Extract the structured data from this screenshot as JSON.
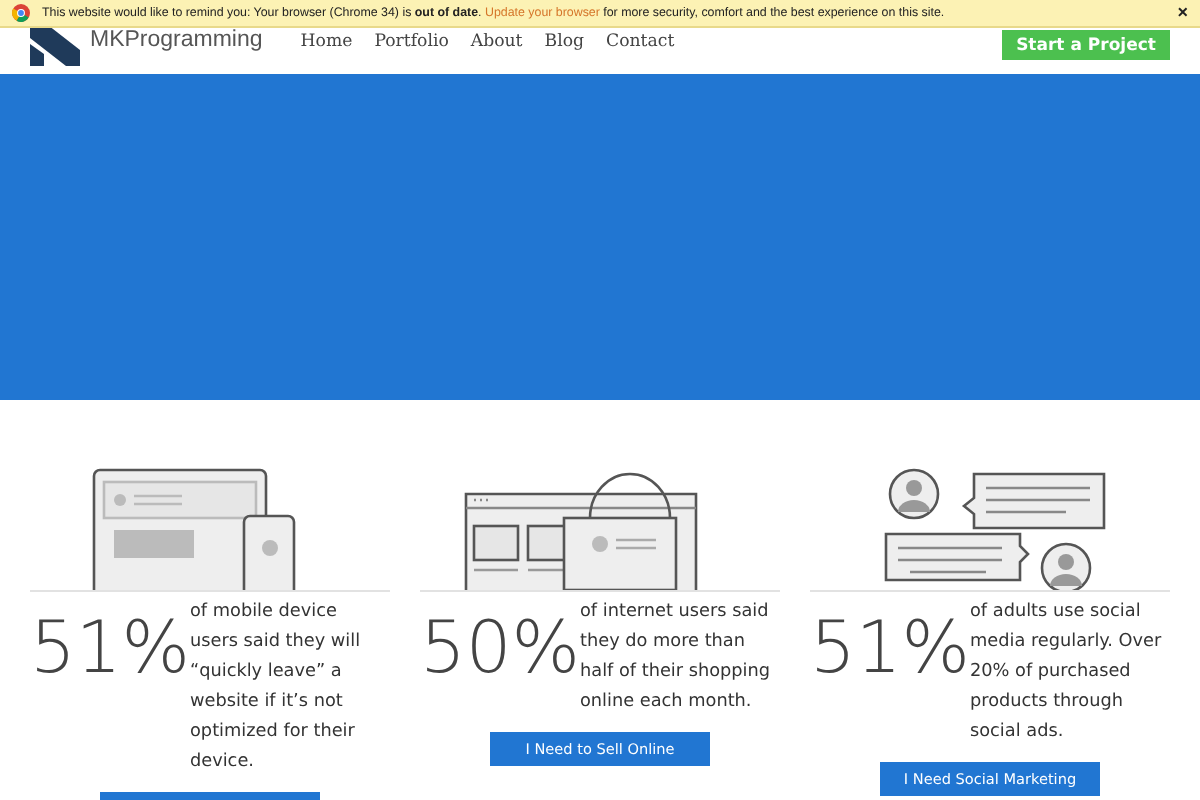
{
  "notice": {
    "text_before": "This website would like to remind you: Your browser (Chrome 34) is **out of date**. ",
    "link": "Update your browser",
    "text_after": " for more security, comfort and the best experience on this site.",
    "close": "×"
  },
  "header": {
    "brand": "MKProgramming",
    "nav": [
      {
        "label": "Home"
      },
      {
        "label": "Portfolio"
      },
      {
        "label": "About"
      },
      {
        "label": "Blog"
      },
      {
        "label": "Contact"
      }
    ],
    "cta": "Start a Project"
  },
  "stats": [
    {
      "kind": "devices",
      "number": "51%",
      "text": "of mobile device users said they will “quickly leave” a website if it’s not optimized for their device."
    },
    {
      "kind": "shop",
      "number": "50%",
      "text": "of internet users said they do more than half of their shopping online each month.",
      "button": "I Need to Sell Online"
    },
    {
      "kind": "chat",
      "number": "51%",
      "text": "of adults use social media regularly. Over 20% of purchased products through social ads.",
      "button": "I Need Social Marketing"
    }
  ]
}
